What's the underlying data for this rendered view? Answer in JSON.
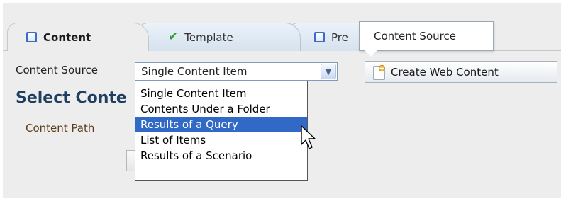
{
  "tabs": [
    {
      "label": "Content",
      "icon": "checkbox-icon",
      "active": true
    },
    {
      "label": "Template",
      "icon": "checkmark-icon",
      "active": false
    },
    {
      "label": "Pre",
      "icon": "checkbox-icon",
      "active": false
    }
  ],
  "tooltip": {
    "text": "Content Source"
  },
  "content_source": {
    "label": "Content Source",
    "selected_value": "Single Content Item",
    "options": [
      "Single Content Item",
      "Contents Under a Folder",
      "Results of a Query",
      "List of Items",
      "Results of a Scenario"
    ],
    "highlighted_index": 2
  },
  "create_button": {
    "label": "Create Web Content",
    "icon": "new-document-icon"
  },
  "section": {
    "title": "Select Conte"
  },
  "content_path": {
    "label": "Content Path"
  },
  "colors": {
    "section_title": "#1e3f60",
    "highlight": "#3169c6",
    "checkmark": "#2e9b2e",
    "path_label": "#5a3e18"
  }
}
